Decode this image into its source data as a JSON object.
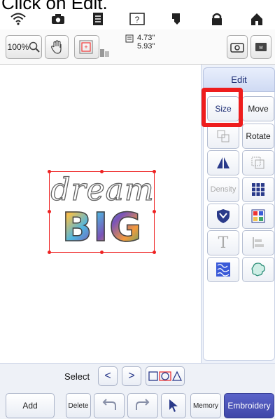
{
  "caption": "Click on Edit.",
  "statusbar": {
    "icons": [
      "wifi-icon",
      "camera-icon",
      "document-icon",
      "help-icon",
      "transfer-icon",
      "lock-icon",
      "home-icon"
    ]
  },
  "toolbar": {
    "zoom_label": "100%",
    "width": "4.73\"",
    "height": "5.93\""
  },
  "design": {
    "line1": "dream",
    "line2": "BIG"
  },
  "panel": {
    "tab_label": "Edit",
    "size": "Size",
    "move": "Move",
    "rotate": "Rotate",
    "density": "Density",
    "text_icon": "T"
  },
  "bottom": {
    "select_label": "Select",
    "prev": "<",
    "next": ">",
    "add": "Add",
    "delete": "Delete",
    "memory": "Memory",
    "embroidery": "Embroidery"
  },
  "colors": {
    "highlight": "#ee1d1d",
    "embroidery_button": "#4b53b8",
    "selection_frame": "#e22222"
  }
}
